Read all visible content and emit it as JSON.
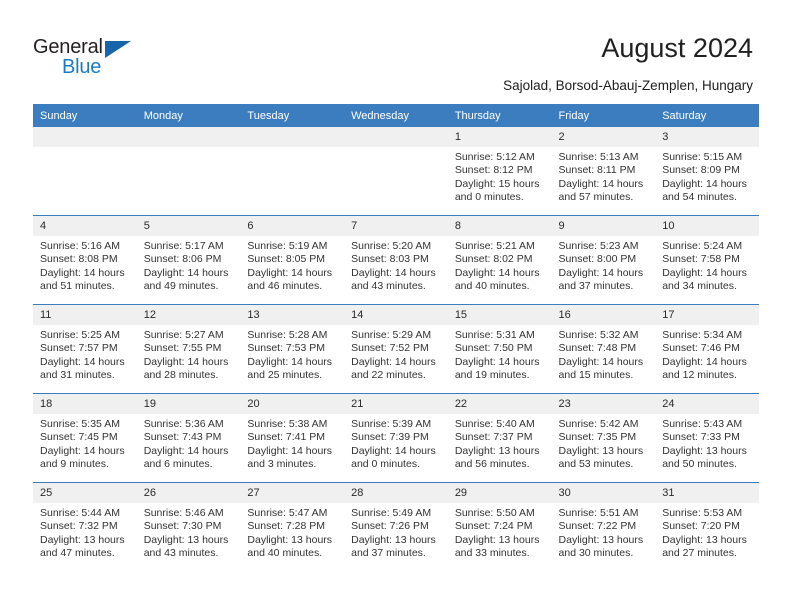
{
  "brand": {
    "name_top": "General",
    "name_bottom": "Blue",
    "triangle_color": "#1565a8",
    "blue_color": "#1b7ac4"
  },
  "header": {
    "title": "August 2024",
    "subtitle": "Sajolad, Borsod-Abauj-Zemplen, Hungary",
    "header_bg": "#3b7dbf",
    "daynum_bg": "#f0f0f0"
  },
  "weekday_headers": [
    "Sunday",
    "Monday",
    "Tuesday",
    "Wednesday",
    "Thursday",
    "Friday",
    "Saturday"
  ],
  "weeks": [
    [
      {
        "day": "",
        "empty": true
      },
      {
        "day": "",
        "empty": true
      },
      {
        "day": "",
        "empty": true
      },
      {
        "day": "",
        "empty": true
      },
      {
        "day": "1",
        "sunrise": "Sunrise: 5:12 AM",
        "sunset": "Sunset: 8:12 PM",
        "daylight_1": "Daylight: 15 hours",
        "daylight_2": "and 0 minutes."
      },
      {
        "day": "2",
        "sunrise": "Sunrise: 5:13 AM",
        "sunset": "Sunset: 8:11 PM",
        "daylight_1": "Daylight: 14 hours",
        "daylight_2": "and 57 minutes."
      },
      {
        "day": "3",
        "sunrise": "Sunrise: 5:15 AM",
        "sunset": "Sunset: 8:09 PM",
        "daylight_1": "Daylight: 14 hours",
        "daylight_2": "and 54 minutes."
      }
    ],
    [
      {
        "day": "4",
        "sunrise": "Sunrise: 5:16 AM",
        "sunset": "Sunset: 8:08 PM",
        "daylight_1": "Daylight: 14 hours",
        "daylight_2": "and 51 minutes."
      },
      {
        "day": "5",
        "sunrise": "Sunrise: 5:17 AM",
        "sunset": "Sunset: 8:06 PM",
        "daylight_1": "Daylight: 14 hours",
        "daylight_2": "and 49 minutes."
      },
      {
        "day": "6",
        "sunrise": "Sunrise: 5:19 AM",
        "sunset": "Sunset: 8:05 PM",
        "daylight_1": "Daylight: 14 hours",
        "daylight_2": "and 46 minutes."
      },
      {
        "day": "7",
        "sunrise": "Sunrise: 5:20 AM",
        "sunset": "Sunset: 8:03 PM",
        "daylight_1": "Daylight: 14 hours",
        "daylight_2": "and 43 minutes."
      },
      {
        "day": "8",
        "sunrise": "Sunrise: 5:21 AM",
        "sunset": "Sunset: 8:02 PM",
        "daylight_1": "Daylight: 14 hours",
        "daylight_2": "and 40 minutes."
      },
      {
        "day": "9",
        "sunrise": "Sunrise: 5:23 AM",
        "sunset": "Sunset: 8:00 PM",
        "daylight_1": "Daylight: 14 hours",
        "daylight_2": "and 37 minutes."
      },
      {
        "day": "10",
        "sunrise": "Sunrise: 5:24 AM",
        "sunset": "Sunset: 7:58 PM",
        "daylight_1": "Daylight: 14 hours",
        "daylight_2": "and 34 minutes."
      }
    ],
    [
      {
        "day": "11",
        "sunrise": "Sunrise: 5:25 AM",
        "sunset": "Sunset: 7:57 PM",
        "daylight_1": "Daylight: 14 hours",
        "daylight_2": "and 31 minutes."
      },
      {
        "day": "12",
        "sunrise": "Sunrise: 5:27 AM",
        "sunset": "Sunset: 7:55 PM",
        "daylight_1": "Daylight: 14 hours",
        "daylight_2": "and 28 minutes."
      },
      {
        "day": "13",
        "sunrise": "Sunrise: 5:28 AM",
        "sunset": "Sunset: 7:53 PM",
        "daylight_1": "Daylight: 14 hours",
        "daylight_2": "and 25 minutes."
      },
      {
        "day": "14",
        "sunrise": "Sunrise: 5:29 AM",
        "sunset": "Sunset: 7:52 PM",
        "daylight_1": "Daylight: 14 hours",
        "daylight_2": "and 22 minutes."
      },
      {
        "day": "15",
        "sunrise": "Sunrise: 5:31 AM",
        "sunset": "Sunset: 7:50 PM",
        "daylight_1": "Daylight: 14 hours",
        "daylight_2": "and 19 minutes."
      },
      {
        "day": "16",
        "sunrise": "Sunrise: 5:32 AM",
        "sunset": "Sunset: 7:48 PM",
        "daylight_1": "Daylight: 14 hours",
        "daylight_2": "and 15 minutes."
      },
      {
        "day": "17",
        "sunrise": "Sunrise: 5:34 AM",
        "sunset": "Sunset: 7:46 PM",
        "daylight_1": "Daylight: 14 hours",
        "daylight_2": "and 12 minutes."
      }
    ],
    [
      {
        "day": "18",
        "sunrise": "Sunrise: 5:35 AM",
        "sunset": "Sunset: 7:45 PM",
        "daylight_1": "Daylight: 14 hours",
        "daylight_2": "and 9 minutes."
      },
      {
        "day": "19",
        "sunrise": "Sunrise: 5:36 AM",
        "sunset": "Sunset: 7:43 PM",
        "daylight_1": "Daylight: 14 hours",
        "daylight_2": "and 6 minutes."
      },
      {
        "day": "20",
        "sunrise": "Sunrise: 5:38 AM",
        "sunset": "Sunset: 7:41 PM",
        "daylight_1": "Daylight: 14 hours",
        "daylight_2": "and 3 minutes."
      },
      {
        "day": "21",
        "sunrise": "Sunrise: 5:39 AM",
        "sunset": "Sunset: 7:39 PM",
        "daylight_1": "Daylight: 14 hours",
        "daylight_2": "and 0 minutes."
      },
      {
        "day": "22",
        "sunrise": "Sunrise: 5:40 AM",
        "sunset": "Sunset: 7:37 PM",
        "daylight_1": "Daylight: 13 hours",
        "daylight_2": "and 56 minutes."
      },
      {
        "day": "23",
        "sunrise": "Sunrise: 5:42 AM",
        "sunset": "Sunset: 7:35 PM",
        "daylight_1": "Daylight: 13 hours",
        "daylight_2": "and 53 minutes."
      },
      {
        "day": "24",
        "sunrise": "Sunrise: 5:43 AM",
        "sunset": "Sunset: 7:33 PM",
        "daylight_1": "Daylight: 13 hours",
        "daylight_2": "and 50 minutes."
      }
    ],
    [
      {
        "day": "25",
        "sunrise": "Sunrise: 5:44 AM",
        "sunset": "Sunset: 7:32 PM",
        "daylight_1": "Daylight: 13 hours",
        "daylight_2": "and 47 minutes."
      },
      {
        "day": "26",
        "sunrise": "Sunrise: 5:46 AM",
        "sunset": "Sunset: 7:30 PM",
        "daylight_1": "Daylight: 13 hours",
        "daylight_2": "and 43 minutes."
      },
      {
        "day": "27",
        "sunrise": "Sunrise: 5:47 AM",
        "sunset": "Sunset: 7:28 PM",
        "daylight_1": "Daylight: 13 hours",
        "daylight_2": "and 40 minutes."
      },
      {
        "day": "28",
        "sunrise": "Sunrise: 5:49 AM",
        "sunset": "Sunset: 7:26 PM",
        "daylight_1": "Daylight: 13 hours",
        "daylight_2": "and 37 minutes."
      },
      {
        "day": "29",
        "sunrise": "Sunrise: 5:50 AM",
        "sunset": "Sunset: 7:24 PM",
        "daylight_1": "Daylight: 13 hours",
        "daylight_2": "and 33 minutes."
      },
      {
        "day": "30",
        "sunrise": "Sunrise: 5:51 AM",
        "sunset": "Sunset: 7:22 PM",
        "daylight_1": "Daylight: 13 hours",
        "daylight_2": "and 30 minutes."
      },
      {
        "day": "31",
        "sunrise": "Sunrise: 5:53 AM",
        "sunset": "Sunset: 7:20 PM",
        "daylight_1": "Daylight: 13 hours",
        "daylight_2": "and 27 minutes."
      }
    ]
  ]
}
